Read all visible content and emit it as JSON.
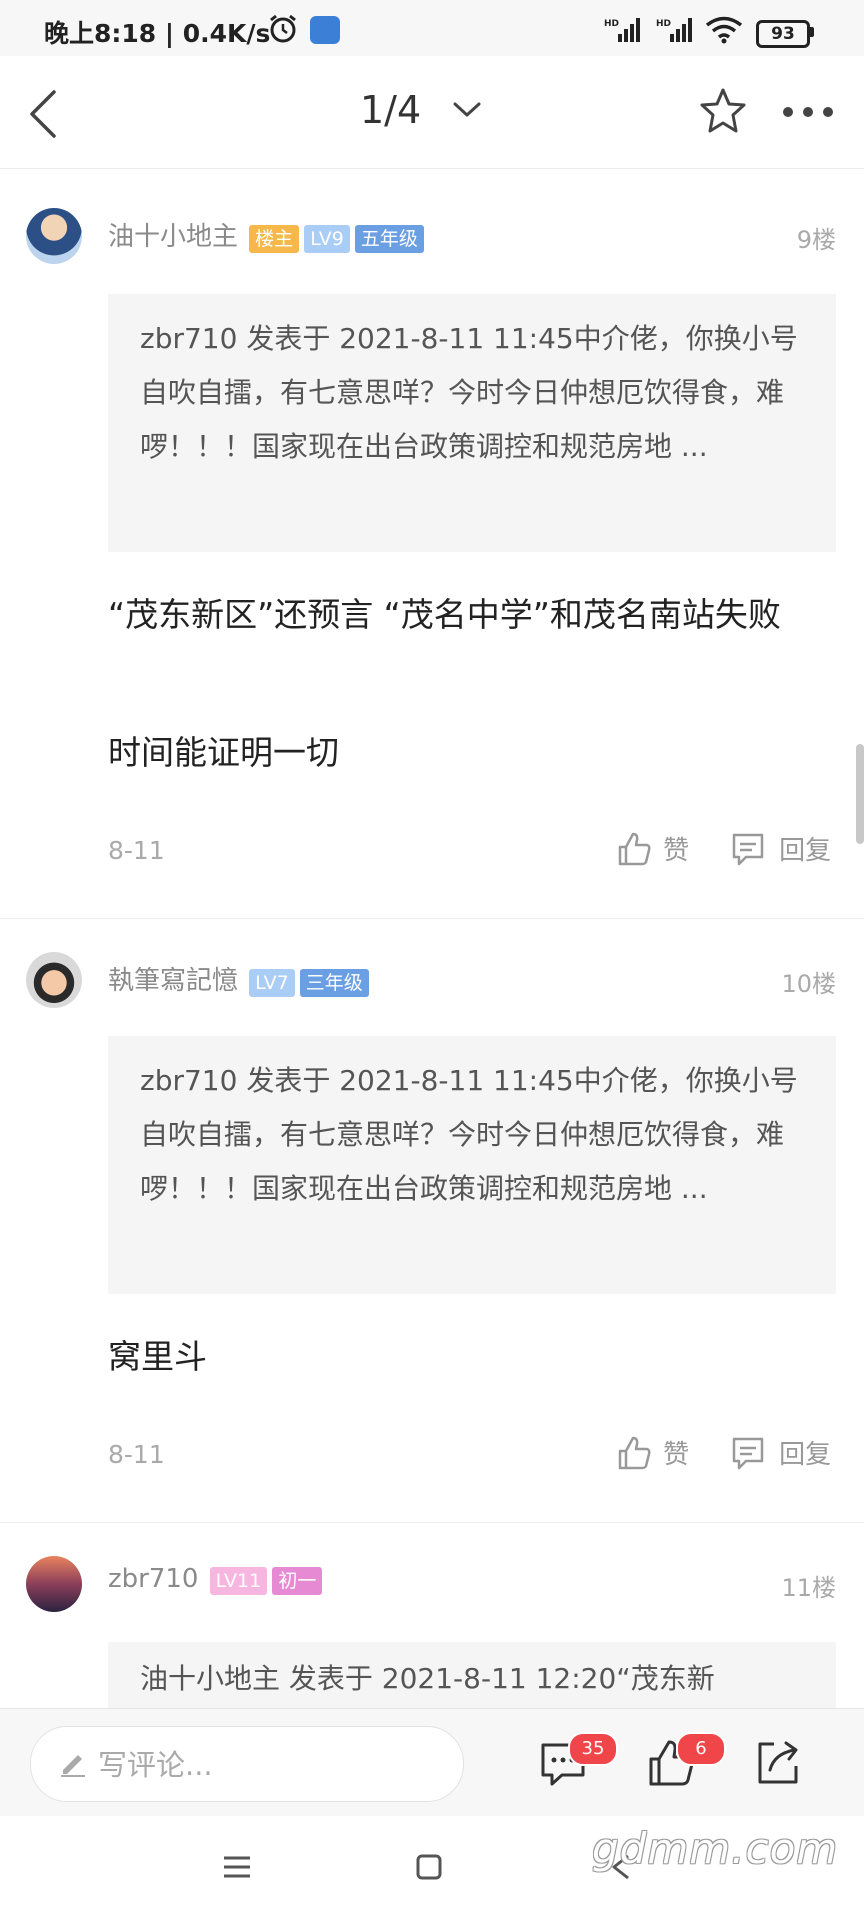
{
  "status_bar": {
    "text": "晚上8:18 | 0.4K/s",
    "battery": "93",
    "icons": [
      "alarm-icon",
      "app-icon",
      "signal-hd-icon",
      "signal-hd-icon",
      "wifi-icon",
      "battery-icon"
    ]
  },
  "header": {
    "page_indicator": "1/4",
    "icons": [
      "back-icon",
      "chevron-down-icon",
      "star-icon",
      "more-icon"
    ]
  },
  "posts": [
    {
      "username": "油十小地主",
      "badges": [
        {
          "label": "楼主",
          "color": "#f6b84b"
        },
        {
          "label": "LV9",
          "color": "#a9cdf5"
        },
        {
          "label": "五年级",
          "color": "#6b9fe4"
        }
      ],
      "floor": "9楼",
      "quote": "zbr710 发表于 2021-8-11 11:45中介佬，你换小号自吹自擂，有七意思咩？今时今日仲想厄饮得食，难啰！！！国家现在出台政策调控和规范房地 ...",
      "body_lines": [
        "“茂东新区”还预言 “茂名中学”和茂名南站失败",
        "时间能证明一切"
      ],
      "date": "8-11",
      "like_label": "赞",
      "reply_label": "回复"
    },
    {
      "username": "執筆寫記憶",
      "badges": [
        {
          "label": "LV7",
          "color": "#a9cdf5"
        },
        {
          "label": "三年级",
          "color": "#6b9fe4"
        }
      ],
      "floor": "10楼",
      "quote": "zbr710 发表于 2021-8-11 11:45中介佬，你换小号自吹自擂，有七意思咩？今时今日仲想厄饮得食，难啰！！！国家现在出台政策调控和规范房地 ...",
      "body_lines": [
        "窝里斗"
      ],
      "date": "8-11",
      "like_label": "赞",
      "reply_label": "回复"
    },
    {
      "username": "zbr710",
      "badges": [
        {
          "label": "LV11",
          "color": "#f6b6e0"
        },
        {
          "label": "初一",
          "color": "#e78ad4"
        }
      ],
      "floor": "11楼",
      "quote": "油十小地主 发表于 2021-8-11 12:20“茂东新"
    }
  ],
  "bottom_bar": {
    "comment_placeholder": "写评论...",
    "comment_count": "35",
    "like_count": "6",
    "icons": [
      "pencil-icon",
      "comment-icon",
      "thumb-up-icon",
      "share-icon"
    ]
  },
  "nav_bar": {
    "icons": [
      "menu-icon",
      "home-square-icon",
      "back-triangle-icon"
    ]
  },
  "watermark": "gdmm.com"
}
